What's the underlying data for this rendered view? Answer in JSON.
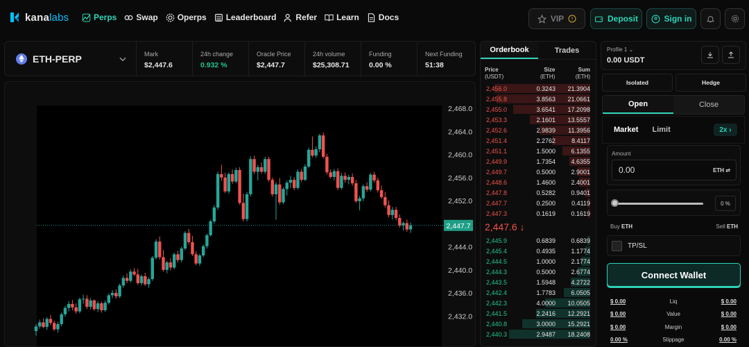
{
  "brand": {
    "name_a": "kana",
    "name_b": "labs",
    "accent": "#2ed3b7"
  },
  "nav": [
    {
      "label": "Perps",
      "icon": "perps-icon",
      "active": true
    },
    {
      "label": "Swap",
      "icon": "swap-icon",
      "active": false
    },
    {
      "label": "Operps",
      "icon": "operps-icon",
      "active": false
    },
    {
      "label": "Leaderboard",
      "icon": "leaderboard-icon",
      "active": false
    },
    {
      "label": "Refer",
      "icon": "refer-icon",
      "active": false
    },
    {
      "label": "Learn",
      "icon": "learn-icon",
      "active": false
    },
    {
      "label": "Docs",
      "icon": "docs-icon",
      "active": false
    }
  ],
  "header": {
    "vip_label": "VIP",
    "deposit_label": "Deposit",
    "signin_label": "Sign in"
  },
  "market": {
    "symbol": "ETH-PERP",
    "stats": [
      {
        "label": "Mark",
        "value": "$2,447.6",
        "color": ""
      },
      {
        "label": "24h change",
        "value": "0.932 %",
        "color": "green"
      },
      {
        "label": "Oracle Price",
        "value": "$2,447.7",
        "color": ""
      },
      {
        "label": "24h volume",
        "value": "$25,308.71",
        "color": ""
      },
      {
        "label": "Funding",
        "value": "0.00 %",
        "color": ""
      },
      {
        "label": "Next Funding",
        "value": "51:38",
        "color": ""
      }
    ]
  },
  "chart_data": {
    "type": "candlestick",
    "y_ticks": [
      "2,468.0",
      "2,464.0",
      "2,460.0",
      "2,456.0",
      "2,452.0",
      "2,448.0",
      "2,444.0",
      "2,440.0",
      "2,436.0",
      "2,432.0"
    ],
    "ylim": [
      2430.0,
      2468.0
    ],
    "last_price_label": "2,447.7",
    "up_color": "#26a69a",
    "down_color": "#ef5350",
    "ohlc": [
      [
        2429.4,
        2430.6,
        2428.6,
        2430.2
      ],
      [
        2430.2,
        2431.4,
        2429.8,
        2430.9
      ],
      [
        2430.9,
        2431.6,
        2429.9,
        2430.1
      ],
      [
        2430.1,
        2431.8,
        2429.6,
        2431.5
      ],
      [
        2431.5,
        2432.2,
        2430.4,
        2430.8
      ],
      [
        2430.8,
        2431.2,
        2429.4,
        2429.7
      ],
      [
        2429.7,
        2431.0,
        2429.1,
        2430.6
      ],
      [
        2430.6,
        2432.6,
        2430.2,
        2432.3
      ],
      [
        2432.3,
        2433.8,
        2431.9,
        2433.4
      ],
      [
        2433.4,
        2434.6,
        2432.8,
        2434.1
      ],
      [
        2434.1,
        2434.8,
        2433.0,
        2433.5
      ],
      [
        2433.5,
        2434.2,
        2432.4,
        2432.8
      ],
      [
        2432.8,
        2435.2,
        2432.5,
        2434.9
      ],
      [
        2434.9,
        2435.7,
        2434.1,
        2435.0
      ],
      [
        2435.0,
        2435.6,
        2433.2,
        2433.6
      ],
      [
        2433.6,
        2435.1,
        2433.1,
        2434.7
      ],
      [
        2434.7,
        2434.9,
        2432.9,
        2433.2
      ],
      [
        2433.2,
        2434.6,
        2432.7,
        2434.2
      ],
      [
        2434.2,
        2434.5,
        2432.6,
        2433.0
      ],
      [
        2433.0,
        2434.7,
        2432.7,
        2434.3
      ],
      [
        2434.3,
        2435.9,
        2434.0,
        2435.6
      ],
      [
        2435.6,
        2436.5,
        2435.1,
        2436.0
      ],
      [
        2436.0,
        2436.6,
        2435.0,
        2435.4
      ],
      [
        2435.4,
        2437.6,
        2435.1,
        2437.3
      ],
      [
        2437.3,
        2439.0,
        2436.9,
        2438.6
      ],
      [
        2438.6,
        2439.4,
        2437.7,
        2438.1
      ],
      [
        2438.1,
        2440.1,
        2437.8,
        2439.7
      ],
      [
        2439.7,
        2440.3,
        2438.9,
        2439.2
      ],
      [
        2439.2,
        2440.2,
        2437.4,
        2437.7
      ],
      [
        2437.7,
        2439.2,
        2437.3,
        2438.9
      ],
      [
        2438.9,
        2439.5,
        2437.2,
        2437.5
      ],
      [
        2437.5,
        2438.7,
        2436.9,
        2438.4
      ],
      [
        2438.4,
        2442.4,
        2438.1,
        2442.1
      ],
      [
        2442.1,
        2445.3,
        2441.8,
        2444.9
      ],
      [
        2444.9,
        2445.8,
        2441.8,
        2442.2
      ],
      [
        2442.2,
        2443.4,
        2439.7,
        2440.0
      ],
      [
        2440.0,
        2441.6,
        2439.4,
        2441.3
      ],
      [
        2441.3,
        2442.0,
        2439.9,
        2440.4
      ],
      [
        2440.4,
        2443.0,
        2440.1,
        2442.7
      ],
      [
        2442.7,
        2443.3,
        2441.3,
        2441.7
      ],
      [
        2441.7,
        2444.0,
        2441.3,
        2443.7
      ],
      [
        2443.7,
        2446.7,
        2443.4,
        2446.4
      ],
      [
        2446.4,
        2447.1,
        2444.4,
        2444.8
      ],
      [
        2444.8,
        2445.9,
        2442.4,
        2442.7
      ],
      [
        2442.7,
        2443.2,
        2440.8,
        2441.1
      ],
      [
        2441.1,
        2442.8,
        2440.7,
        2442.5
      ],
      [
        2442.5,
        2444.4,
        2442.2,
        2444.1
      ],
      [
        2444.1,
        2446.3,
        2443.7,
        2446.0
      ],
      [
        2446.0,
        2448.7,
        2445.8,
        2448.4
      ],
      [
        2448.4,
        2451.2,
        2448.0,
        2450.8
      ],
      [
        2450.8,
        2457.0,
        2450.4,
        2456.6
      ],
      [
        2456.6,
        2458.2,
        2455.4,
        2456.0
      ],
      [
        2456.0,
        2456.8,
        2453.3,
        2453.6
      ],
      [
        2453.6,
        2456.9,
        2453.2,
        2456.6
      ],
      [
        2456.6,
        2457.4,
        2454.9,
        2455.3
      ],
      [
        2455.3,
        2457.7,
        2455.0,
        2457.3
      ],
      [
        2457.3,
        2457.8,
        2451.3,
        2451.6
      ],
      [
        2451.6,
        2453.2,
        2448.4,
        2448.8
      ],
      [
        2448.8,
        2453.5,
        2448.4,
        2453.1
      ],
      [
        2453.1,
        2459.7,
        2452.7,
        2459.2
      ],
      [
        2459.2,
        2459.8,
        2456.6,
        2457.0
      ],
      [
        2457.0,
        2458.2,
        2455.5,
        2457.8
      ],
      [
        2457.8,
        2458.6,
        2456.7,
        2457.0
      ],
      [
        2457.0,
        2459.6,
        2456.6,
        2459.2
      ],
      [
        2459.2,
        2459.6,
        2455.3,
        2455.6
      ],
      [
        2455.6,
        2456.0,
        2452.7,
        2453.1
      ],
      [
        2453.1,
        2455.2,
        2448.7,
        2454.8
      ],
      [
        2454.8,
        2455.9,
        2451.3,
        2451.7
      ],
      [
        2451.7,
        2454.3,
        2451.4,
        2454.0
      ],
      [
        2454.0,
        2455.5,
        2452.9,
        2455.1
      ],
      [
        2455.1,
        2456.3,
        2454.2,
        2455.6
      ],
      [
        2455.6,
        2456.1,
        2453.8,
        2454.2
      ],
      [
        2454.2,
        2457.4,
        2453.9,
        2457.0
      ],
      [
        2457.0,
        2457.5,
        2455.2,
        2455.6
      ],
      [
        2455.6,
        2458.3,
        2455.4,
        2457.9
      ],
      [
        2457.9,
        2461.2,
        2457.6,
        2460.8
      ],
      [
        2460.8,
        2463.1,
        2459.5,
        2459.8
      ],
      [
        2459.8,
        2461.4,
        2459.4,
        2460.9
      ],
      [
        2460.9,
        2463.6,
        2460.4,
        2463.3
      ],
      [
        2463.3,
        2463.8,
        2459.3,
        2459.6
      ],
      [
        2459.6,
        2460.1,
        2456.5,
        2456.9
      ],
      [
        2456.9,
        2457.4,
        2455.8,
        2456.1
      ],
      [
        2456.1,
        2457.5,
        2455.5,
        2457.1
      ],
      [
        2457.1,
        2457.6,
        2453.8,
        2454.2
      ],
      [
        2454.2,
        2456.8,
        2453.9,
        2456.3
      ],
      [
        2456.3,
        2456.9,
        2455.1,
        2455.6
      ],
      [
        2455.6,
        2456.5,
        2454.8,
        2456.1
      ],
      [
        2456.1,
        2456.7,
        2454.6,
        2455.0
      ],
      [
        2455.0,
        2455.6,
        2451.6,
        2451.9
      ],
      [
        2451.9,
        2452.8,
        2450.3,
        2452.4
      ],
      [
        2452.4,
        2454.8,
        2451.9,
        2454.5
      ],
      [
        2454.5,
        2455.2,
        2453.5,
        2453.9
      ],
      [
        2453.9,
        2456.8,
        2453.6,
        2456.5
      ],
      [
        2456.5,
        2457.0,
        2455.1,
        2455.5
      ],
      [
        2455.5,
        2456.0,
        2453.4,
        2453.8
      ],
      [
        2453.8,
        2454.6,
        2452.3,
        2452.6
      ],
      [
        2452.6,
        2453.5,
        2450.8,
        2451.2
      ],
      [
        2451.2,
        2452.0,
        2449.1,
        2449.5
      ],
      [
        2449.5,
        2450.9,
        2448.7,
        2450.4
      ],
      [
        2450.4,
        2450.9,
        2448.6,
        2449.0
      ],
      [
        2449.0,
        2449.6,
        2447.3,
        2447.7
      ],
      [
        2447.7,
        2448.4,
        2446.8,
        2448.1
      ],
      [
        2448.1,
        2448.7,
        2446.6,
        2447.0
      ],
      [
        2447.0,
        2448.2,
        2446.4,
        2447.7
      ]
    ]
  },
  "orderbook": {
    "tabs": [
      "Orderbook",
      "Trades"
    ],
    "head": {
      "price": "Price",
      "price_unit": "(USDT)",
      "size": "Size",
      "size_unit": "(ETH)",
      "sum": "Sum",
      "sum_unit": "(ETH)"
    },
    "asks": [
      [
        "2,456.0",
        "0.3243",
        "21.3904",
        0.93
      ],
      [
        "2,455.8",
        "3.8563",
        "21.0661",
        0.91
      ],
      [
        "2,455.0",
        "3.6541",
        "17.2098",
        0.75
      ],
      [
        "2,453.3",
        "2.1601",
        "13.5557",
        0.59
      ],
      [
        "2,452.6",
        "2.9839",
        "11.3956",
        0.49
      ],
      [
        "2,451.4",
        "2.2762",
        "8.4117",
        0.37
      ],
      [
        "2,451.1",
        "1.5000",
        "6.1355",
        0.27
      ],
      [
        "2,449.9",
        "1.7354",
        "4.6355",
        0.2
      ],
      [
        "2,449.7",
        "0.5000",
        "2.9001",
        0.13
      ],
      [
        "2,448.6",
        "1.4600",
        "2.4001",
        0.11
      ],
      [
        "2,447.8",
        "0.5282",
        "0.9401",
        0.05
      ],
      [
        "2,447.7",
        "0.2500",
        "0.4119",
        0.03
      ],
      [
        "2,447.3",
        "0.1619",
        "0.1619",
        0.02
      ]
    ],
    "mid_price": "2,447.6 ↓",
    "bids": [
      [
        "2,445.9",
        "0.6839",
        "0.6839",
        0.03
      ],
      [
        "2,445.4",
        "0.4935",
        "1.1774",
        0.05
      ],
      [
        "2,444.5",
        "1.0000",
        "2.1774",
        0.09
      ],
      [
        "2,444.3",
        "0.5000",
        "2.6774",
        0.12
      ],
      [
        "2,443.5",
        "1.5948",
        "4.2722",
        0.19
      ],
      [
        "2,442.4",
        "1.7783",
        "6.0505",
        0.26
      ],
      [
        "2,442.3",
        "4.0000",
        "10.0505",
        0.44
      ],
      [
        "2,441.5",
        "2.2416",
        "12.2921",
        0.53
      ],
      [
        "2,440.8",
        "3.0000",
        "15.2921",
        0.66
      ],
      [
        "2,440.3",
        "2.9487",
        "18.2408",
        0.79
      ]
    ]
  },
  "trade": {
    "profile_label": "Profile 1",
    "balance": "0.00 USDT",
    "mode_isolated": "Isolated",
    "mode_hedge": "Hedge",
    "open_label": "Open",
    "close_label": "Close",
    "market_label": "Market",
    "limit_label": "Limit",
    "leverage": "2x",
    "amount_label": "Amount",
    "amount_value": "0.00",
    "amount_unit": "ETH",
    "pct_value": "0",
    "pct_unit": "%",
    "slider_value": 0,
    "buy_label": "Buy",
    "buy_asset": "ETH",
    "sell_label": "Sell",
    "sell_asset": "ETH",
    "tpsl_label": "TP/SL",
    "connect_label": "Connect Wallet",
    "stats": [
      {
        "left": "$ 0.00",
        "label": "Liq",
        "right": "$ 0.00"
      },
      {
        "left": "$ 0.00",
        "label": "Value",
        "right": "$ 0.00"
      },
      {
        "left": "$ 0.00",
        "label": "Margin",
        "right": "$ 0.00"
      },
      {
        "left": "0.00 %",
        "label": "Slippage",
        "right": "0.00 %"
      }
    ]
  }
}
